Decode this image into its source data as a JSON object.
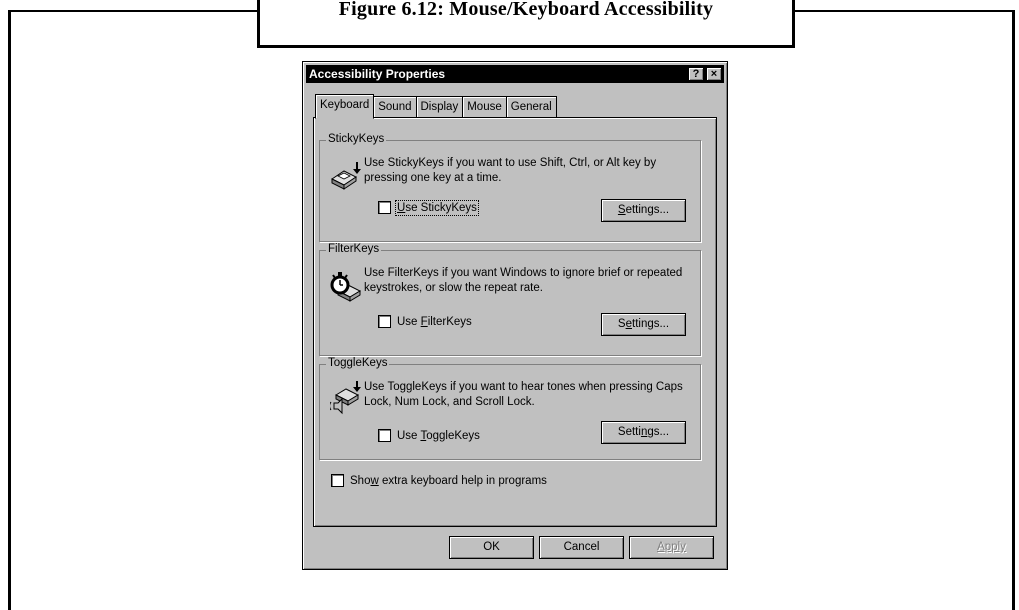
{
  "figure": {
    "caption": "Figure 6.12: Mouse/Keyboard Accessibility"
  },
  "window": {
    "title": "Accessibility Properties",
    "help_button": "?",
    "close_button": "×"
  },
  "tabs": [
    {
      "label": "Keyboard",
      "active": true
    },
    {
      "label": "Sound",
      "active": false
    },
    {
      "label": "Display",
      "active": false
    },
    {
      "label": "Mouse",
      "active": false
    },
    {
      "label": "General",
      "active": false
    }
  ],
  "sticky": {
    "title": "StickyKeys",
    "desc": "Use StickyKeys if you want to use Shift, Ctrl, or Alt key by pressing one key at a time.",
    "checkbox_pre": "",
    "checkbox_mnemonic": "U",
    "checkbox_post": "se StickyKeys",
    "checked": false,
    "settings_mnemonic": "S",
    "settings_post": "ettings...",
    "icon": "keyboard-arrow-icon"
  },
  "filter": {
    "title": "FilterKeys",
    "desc": "Use FilterKeys if you want Windows to ignore brief or repeated keystrokes, or slow the repeat rate.",
    "checkbox_pre": "Use ",
    "checkbox_mnemonic": "F",
    "checkbox_post": "ilterKeys",
    "checked": false,
    "settings_pre": "S",
    "settings_mnemonic": "e",
    "settings_post": "ttings...",
    "icon": "stopwatch-key-icon"
  },
  "toggle": {
    "title": "ToggleKeys",
    "desc": "Use ToggleKeys if you want to hear tones when pressing Caps Lock, Num Lock, and Scroll Lock.",
    "checkbox_pre": "Use ",
    "checkbox_mnemonic": "T",
    "checkbox_post": "oggleKeys",
    "checked": false,
    "settings_pre": "Setti",
    "settings_mnemonic": "n",
    "settings_post": "gs...",
    "icon": "speaker-key-icon"
  },
  "extra": {
    "pre": "Sho",
    "mnemonic": "w",
    "post": " extra keyboard help in programs",
    "checked": false
  },
  "footer": {
    "ok": "OK",
    "cancel": "Cancel",
    "apply": "Apply"
  }
}
